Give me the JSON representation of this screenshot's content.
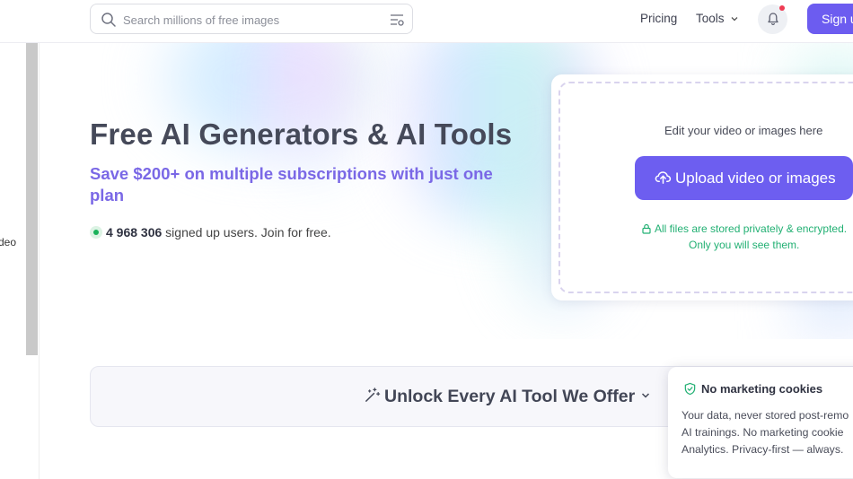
{
  "header": {
    "search_placeholder": "Search millions of free images",
    "nav_pricing": "Pricing",
    "nav_tools": "Tools",
    "signup_label": "Sign up"
  },
  "sidebar": {
    "partial_label": "deo"
  },
  "hero": {
    "title": "Free AI Generators & AI Tools",
    "subtitle": "Save $200+ on multiple subscriptions with just one plan",
    "user_count": "4 968 306",
    "user_text": " signed up users. Join for free."
  },
  "upload": {
    "edit_text": "Edit your video or images here",
    "button_label": "Upload video or images",
    "secure_line1": "All files are stored privately & encrypted.",
    "secure_line2": "Only you will see them."
  },
  "unlock": {
    "label": "Unlock Every AI Tool We Offer"
  },
  "cookie": {
    "title": "No marketing cookies",
    "line1": "Your data, never stored post-remo",
    "line2": "AI trainings. No marketing cookie",
    "line3": "Analytics. Privacy-first — always."
  },
  "colors": {
    "accent": "#6c5cf0",
    "subtitle": "#7a68e6",
    "secure_green": "#22b073",
    "notification_dot": "#ef3b53"
  }
}
